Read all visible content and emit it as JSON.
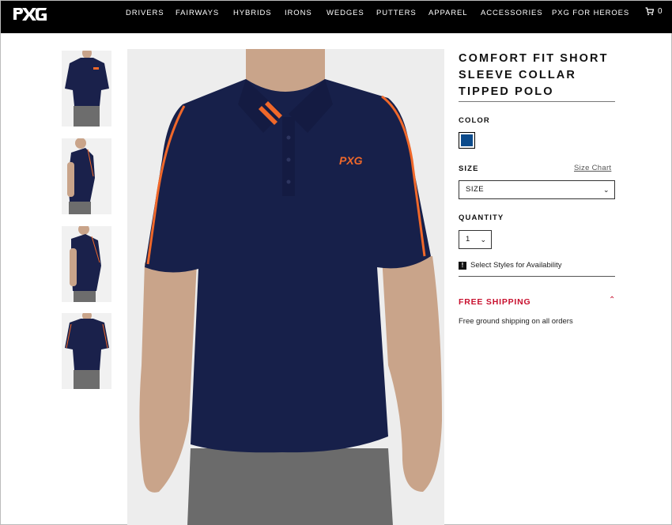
{
  "header": {
    "logo_text": "PXG",
    "nav": [
      "DRIVERS",
      "FAIRWAYS",
      "HYBRIDS",
      "IRONS",
      "WEDGES",
      "PUTTERS",
      "APPAREL",
      "ACCESSORIES",
      "PXG FOR HEROES"
    ],
    "cart_count": "0",
    "cart_icon": "cart-icon"
  },
  "gallery": {
    "thumbnails": [
      "front view",
      "side view",
      "side angle view",
      "back view"
    ],
    "main_image": "model wearing navy polo with orange tipping"
  },
  "product": {
    "title": "COMFORT FIT SHORT SLEEVE COLLAR TIPPED POLO",
    "color_label": "COLOR",
    "selected_color": "#0c4b8c",
    "size_label": "SIZE",
    "size_chart_link": "Size Chart",
    "size_select_value": "SIZE",
    "quantity_label": "QUANTITY",
    "quantity_value": "1",
    "availability_text": "Select Styles for Availability",
    "availability_icon": "!",
    "shipping_title": "FREE SHIPPING",
    "shipping_text": "Free ground shipping on all orders"
  },
  "colors": {
    "accent_red": "#c8102e",
    "polo_navy": "#17204a",
    "tipping_orange": "#f0682a"
  }
}
